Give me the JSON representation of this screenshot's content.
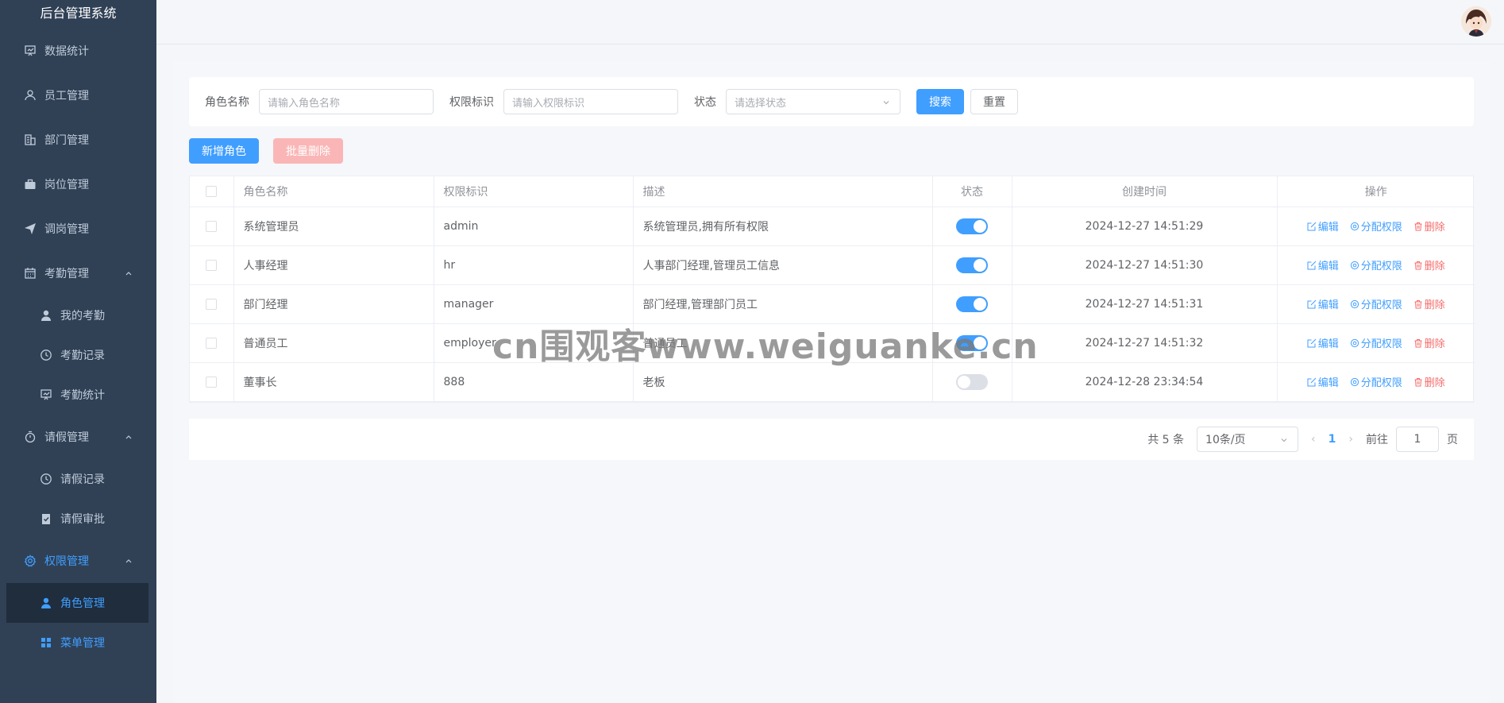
{
  "app": {
    "title": "后台管理系统"
  },
  "sidebar": {
    "items": [
      {
        "label": "数据统计",
        "icon": "chart-board-icon"
      },
      {
        "label": "员工管理",
        "icon": "user-icon"
      },
      {
        "label": "部门管理",
        "icon": "building-icon"
      },
      {
        "label": "岗位管理",
        "icon": "briefcase-icon"
      },
      {
        "label": "调岗管理",
        "icon": "send-icon"
      },
      {
        "label": "考勤管理",
        "icon": "calendar-icon"
      },
      {
        "label": "我的考勤",
        "icon": "person-icon"
      },
      {
        "label": "考勤记录",
        "icon": "clock-icon"
      },
      {
        "label": "考勤统计",
        "icon": "chart-board-icon"
      },
      {
        "label": "请假管理",
        "icon": "stopwatch-icon"
      },
      {
        "label": "请假记录",
        "icon": "clock-icon"
      },
      {
        "label": "请假审批",
        "icon": "clipboard-check-icon"
      },
      {
        "label": "权限管理",
        "icon": "gear-icon"
      },
      {
        "label": "角色管理",
        "icon": "person-icon"
      },
      {
        "label": "菜单管理",
        "icon": "grid-icon"
      }
    ]
  },
  "search": {
    "role_name_label": "角色名称",
    "role_name_placeholder": "请输入角色名称",
    "perm_label": "权限标识",
    "perm_placeholder": "请输入权限标识",
    "status_label": "状态",
    "status_placeholder": "请选择状态",
    "search_button": "搜索",
    "reset_button": "重置"
  },
  "actions": {
    "add_role": "新增角色",
    "batch_delete": "批量删除"
  },
  "table": {
    "headers": [
      "角色名称",
      "权限标识",
      "描述",
      "状态",
      "创建时间",
      "操作"
    ],
    "rows": [
      {
        "name": "系统管理员",
        "key": "admin",
        "desc": "系统管理员,拥有所有权限",
        "enabled": true,
        "created": "2024-12-27 14:51:29"
      },
      {
        "name": "人事经理",
        "key": "hr",
        "desc": "人事部门经理,管理员工信息",
        "enabled": true,
        "created": "2024-12-27 14:51:30"
      },
      {
        "name": "部门经理",
        "key": "manager",
        "desc": "部门经理,管理部门员工",
        "enabled": true,
        "created": "2024-12-27 14:51:31"
      },
      {
        "name": "普通员工",
        "key": "employer",
        "desc": "普通员工",
        "enabled": true,
        "created": "2024-12-27 14:51:32"
      },
      {
        "name": "董事长",
        "key": "888",
        "desc": "老板",
        "enabled": false,
        "created": "2024-12-28 23:34:54"
      }
    ],
    "ops": {
      "edit": "编辑",
      "assign": "分配权限",
      "delete": "删除"
    }
  },
  "pagination": {
    "total_text": "共 5 条",
    "page_size": "10条/页",
    "current_page": "1",
    "goto_label": "前往",
    "goto_value": "1",
    "page_suffix": "页"
  },
  "watermark": "cn围观客www.weiguanke.cn",
  "colors": {
    "primary": "#409eff",
    "danger": "#f56c6c",
    "sidebar_bg": "#304156"
  }
}
